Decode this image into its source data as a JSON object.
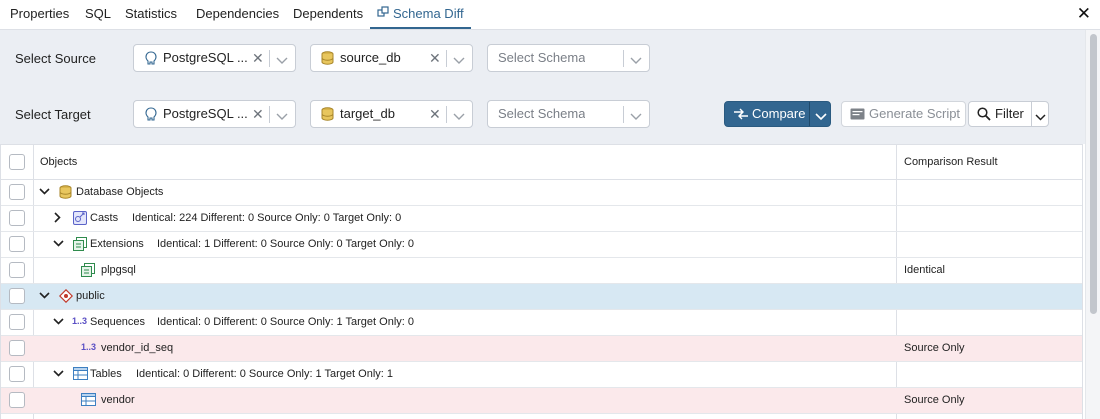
{
  "tabs": [
    {
      "label": "Properties",
      "active": false
    },
    {
      "label": "SQL",
      "active": false
    },
    {
      "label": "Statistics",
      "active": false
    },
    {
      "label": "Dependencies",
      "active": false
    },
    {
      "label": "Dependents",
      "active": false
    },
    {
      "label": "Schema Diff",
      "active": true,
      "icon": "schema-diff-icon"
    }
  ],
  "close_icon": "close-icon",
  "source": {
    "label": "Select Source",
    "server": "PostgreSQL ...",
    "database": "source_db",
    "schema_placeholder": "Select Schema"
  },
  "target": {
    "label": "Select Target",
    "server": "PostgreSQL ...",
    "database": "target_db",
    "schema_placeholder": "Select Schema"
  },
  "actions": {
    "compare_label": "Compare",
    "generate_label": "Generate Script",
    "filter_label": "Filter"
  },
  "grid": {
    "headers": {
      "objects": "Objects",
      "result": "Comparison Result"
    },
    "rows": [
      {
        "label": "Database Objects",
        "summary": "",
        "result": "",
        "icon": "database-icon",
        "expander": "expanded"
      },
      {
        "label": "Casts",
        "summary": "Identical: 224 Different: 0 Source Only: 0 Target Only: 0",
        "result": "",
        "icon": "cast-icon",
        "expander": "collapsed"
      },
      {
        "label": "Extensions",
        "summary": "Identical: 1 Different: 0 Source Only: 0 Target Only: 0",
        "result": "",
        "icon": "extension-icon",
        "expander": "expanded"
      },
      {
        "label": "plpgsql",
        "summary": "",
        "result": "Identical",
        "icon": "extension-icon",
        "expander": "none"
      },
      {
        "label": "public",
        "summary": "",
        "result": "",
        "icon": "schema-icon",
        "expander": "expanded",
        "highlight": "selected"
      },
      {
        "label": "Sequences",
        "summary": "Identical: 0 Different: 0 Source Only: 1 Target Only: 0",
        "result": "",
        "icon": "sequence-icon",
        "expander": "expanded"
      },
      {
        "label": "vendor_id_seq",
        "summary": "",
        "result": "Source Only",
        "icon": "sequence-icon",
        "expander": "none",
        "highlight": "source-only"
      },
      {
        "label": "Tables",
        "summary": "Identical: 0 Different: 0 Source Only: 1 Target Only: 1",
        "result": "",
        "icon": "table-icon",
        "expander": "expanded"
      },
      {
        "label": "vendor",
        "summary": "",
        "result": "Source Only",
        "icon": "table-icon",
        "expander": "none",
        "highlight": "source-only"
      }
    ],
    "sequence_glyph": "1..3"
  },
  "colors": {
    "accent": "#326690",
    "selected_row": "#d7e8f3",
    "source_only_row": "#fbe9eb",
    "control_bg": "#ebeef3"
  }
}
